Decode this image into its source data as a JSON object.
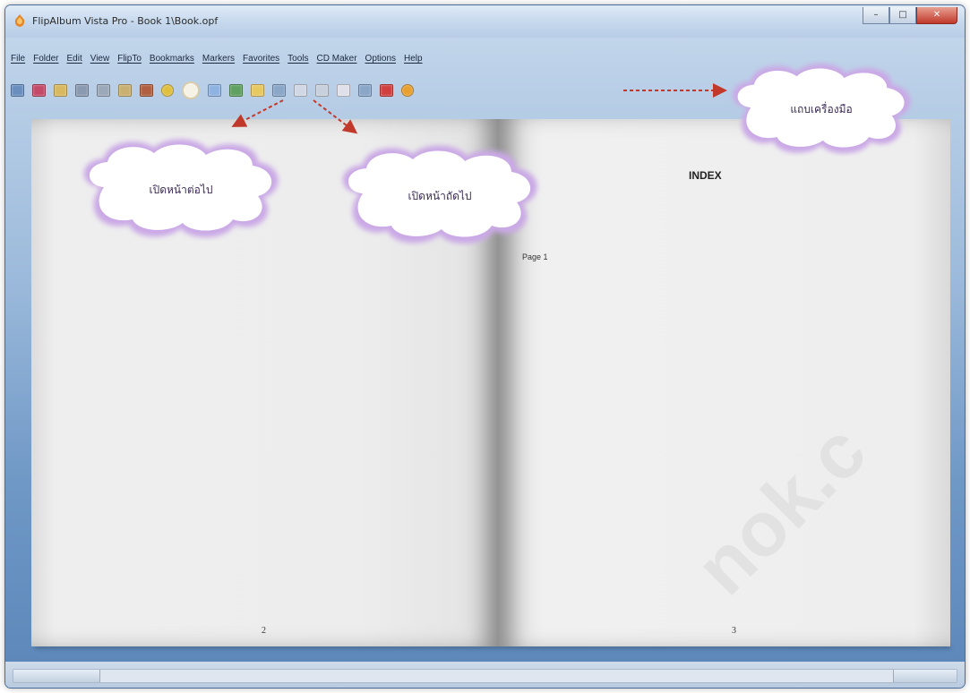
{
  "window": {
    "title": "FlipAlbum Vista Pro - Book 1\\Book.opf",
    "controls": {
      "minimize": "–",
      "maximize": "□",
      "close": "✕"
    }
  },
  "menu": [
    "File",
    "Folder",
    "Edit",
    "View",
    "FlipTo",
    "Bookmarks",
    "Markers",
    "Favorites",
    "Tools",
    "CD Maker",
    "Options",
    "Help"
  ],
  "toolbar": {
    "icons": [
      {
        "name": "open-icon",
        "color": "#6a8fbf"
      },
      {
        "name": "album-icon",
        "color": "#c44a6a"
      },
      {
        "name": "gallery-icon",
        "color": "#d8b860"
      },
      {
        "name": "print-icon",
        "color": "#8a9ab0"
      },
      {
        "name": "email-icon",
        "color": "#9aa8b8"
      },
      {
        "name": "disk-icon",
        "color": "#c8b070"
      },
      {
        "name": "photo-icon",
        "color": "#b06040"
      },
      {
        "name": "back-cover-icon",
        "color": "#e0c040"
      },
      {
        "name": "previous-page-icon",
        "color": "#f6f3e6"
      },
      {
        "name": "next-page-icon",
        "color": "#8fb3e0"
      },
      {
        "name": "turn-page-icon",
        "color": "#60a060"
      },
      {
        "name": "thumbnail-icon",
        "color": "#e8c860"
      },
      {
        "name": "zoom-icon",
        "color": "#8aa6c8"
      },
      {
        "name": "slideshow-icon",
        "color": "#d0d8e4"
      },
      {
        "name": "settings-icon",
        "color": "#c8d0dc"
      },
      {
        "name": "cd-icon",
        "color": "#e0e0e8"
      },
      {
        "name": "music-icon",
        "color": "#8aa6c8"
      },
      {
        "name": "flag-icon",
        "color": "#d04040"
      },
      {
        "name": "audio-tools-icon",
        "color": "#e8a030"
      }
    ]
  },
  "book": {
    "right_page": {
      "title": "INDEX",
      "entry": "Page 1",
      "page_number": "3"
    },
    "left_page": {
      "page_number": "2"
    }
  },
  "callouts": {
    "previous_page": "เปิดหน้าต่อไป",
    "next_page": "เปิดหน้าถัดไป",
    "toolbar_tip": "แถบเครื่องมือ"
  },
  "colors": {
    "cloud_fill": "#ffffff",
    "cloud_glow": "#9b6fc4",
    "arrow": "#c0392b"
  },
  "watermark": "nok.c"
}
